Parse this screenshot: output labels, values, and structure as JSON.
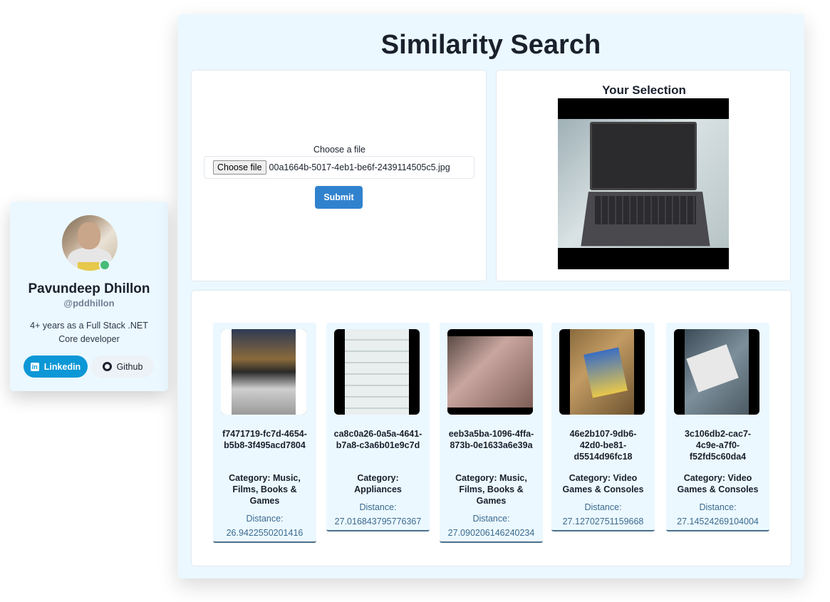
{
  "profile": {
    "name": "Pavundeep Dhillon",
    "handle": "@pddhillon",
    "bio": "4+ years as a Full Stack .NET Core developer",
    "linkedin_label": "Linkedin",
    "github_label": "Github"
  },
  "page": {
    "title": "Similarity Search"
  },
  "upload": {
    "label": "Choose a file",
    "choose_button": "Choose file",
    "file_name": "00a1664b-5017-4eb1-be6f-2439114505c5.jpg",
    "submit_label": "Submit"
  },
  "selection": {
    "title": "Your Selection"
  },
  "results": [
    {
      "id": "f7471719-fc7d-4654-b5b8-3f495acd7804",
      "category": "Category: Music, Films, Books & Games",
      "distance_label": "Distance:",
      "distance": "26.9422550201416"
    },
    {
      "id": "ca8c0a26-0a5a-4641-b7a8-c3a6b01e9c7d",
      "category": "Category: Appliances",
      "distance_label": "Distance:",
      "distance": "27.016843795776367"
    },
    {
      "id": "eeb3a5ba-1096-4ffa-873b-0e1633a6e39a",
      "category": "Category: Music, Films, Books & Games",
      "distance_label": "Distance:",
      "distance": "27.090206146240234"
    },
    {
      "id": "46e2b107-9db6-42d0-be81-d5514d96fc18",
      "category": "Category: Video Games & Consoles",
      "distance_label": "Distance:",
      "distance": "27.12702751159668"
    },
    {
      "id": "3c106db2-cac7-4c9e-a7f0-f52fd5c60da4",
      "category": "Category: Video Games & Consoles",
      "distance_label": "Distance:",
      "distance": "27.14524269104004"
    }
  ]
}
